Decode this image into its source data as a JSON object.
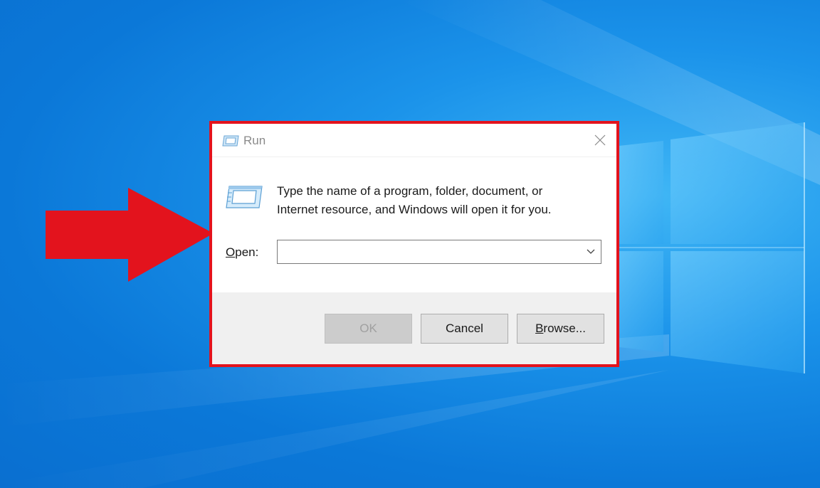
{
  "dialog": {
    "title": "Run",
    "close_symbol": "✕",
    "description_line1": "Type the name of a program, folder, document, or",
    "description_line2": "Internet resource, and Windows will open it for you.",
    "open_label_accel": "O",
    "open_label_rest": "pen:",
    "open_value": "",
    "buttons": {
      "ok": "OK",
      "cancel": "Cancel",
      "browse_accel": "B",
      "browse_rest": "rowse..."
    }
  },
  "icons": {
    "title_icon": "run-icon",
    "big_icon": "run-icon",
    "close_icon": "close-icon",
    "dropdown_icon": "chevron-down-icon",
    "pointer": "red-arrow-icon"
  },
  "colors": {
    "highlight": "#e3131d",
    "desktop": "#0b78d8",
    "button_bar": "#f0f0f0"
  }
}
